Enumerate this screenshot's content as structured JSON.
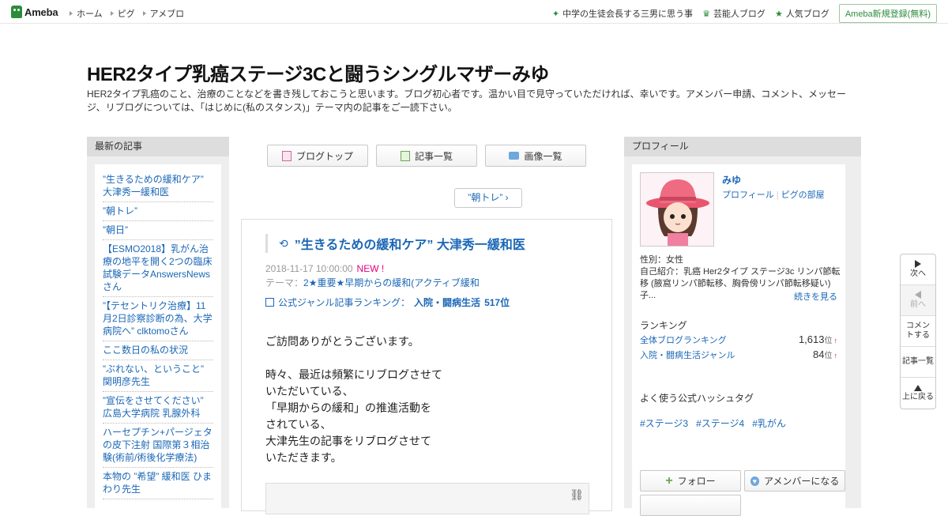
{
  "topbar": {
    "logo": "Ameba",
    "nav": [
      "ホーム",
      "ピグ",
      "アメブロ"
    ],
    "right_links": [
      "中学の生徒会長する三男に思う事",
      "芸能人ブログ",
      "人気ブログ"
    ],
    "signup": "Ameba新規登録(無料)"
  },
  "header": {
    "title": "HER2タイプ乳癌ステージ3Cと闘うシングルマザーみゆ",
    "description": "HER2タイプ乳癌のこと、治療のことなどを書き残しておこうと思います。ブログ初心者です。温かい目で見守っていただければ、幸いです。アメンバー申請、コメント、メッセージ、リブログについては、「はじめに(私のスタンス)」テーマ内の記事をご一読下さい。"
  },
  "left": {
    "heading": "最新の記事",
    "items": [
      "”生きるための緩和ケア” 大津秀一緩和医",
      "”朝トレ”",
      "”朝日”",
      "【ESMO2018】乳がん治療の地平を開く2つの臨床試験データAnswersNewsさん",
      "”【テセントリク治療】11月2日診察診断の為、大学病院へ” clktomoさん",
      "ここ数日の私の状況",
      "”ぶれない、ということ” 関明彦先生",
      "”宣伝をさせてください” 広島大学病院 乳腺外科",
      "ハーセプチン+パージェタの皮下注射 国際第３相治験(術前/術後化学療法)",
      "本物の ”希望” 緩和医 ひまわり先生"
    ]
  },
  "center": {
    "buttons": [
      "ブログトップ",
      "記事一覧",
      "画像一覧"
    ],
    "next": "”朝トレ”",
    "article": {
      "title": "”生きるための緩和ケア” 大津秀一緩和医",
      "date": "2018-11-17 10:00:00",
      "new_badge": "NEW !",
      "theme_label": "テーマ：",
      "theme": "2★重要★早期からの緩和(アクティブ緩和",
      "ranking_label": "公式ジャンル記事ランキング：",
      "ranking_genre": "入院・闘病生活",
      "ranking_value": "517位",
      "body": [
        "ご訪問ありがとうございます。",
        "",
        "時々、最近は頻繁にリブログさせて",
        "いただいている、",
        "「早期からの緩和」の推進活動を",
        "されている、",
        "大津先生の記事をリブログさせて",
        "いただきます。"
      ]
    }
  },
  "right": {
    "heading": "プロフィール",
    "name": "みゆ",
    "links": [
      "プロフィール",
      "ピグの部屋"
    ],
    "gender": "性別：女性",
    "intro": "自己紹介：乳癌 Her2タイプ ステージ3c リンパ節転移 (腋窩リンパ節転移、胸骨傍リンパ節転移疑い) 子...",
    "more": "続きを見る",
    "ranking_title": "ランキング",
    "rankings": [
      {
        "label": "全体ブログランキング",
        "value": "1,613",
        "unit": "位",
        "arrow": "↑"
      },
      {
        "label": "入院・闘病生活ジャンル",
        "value": "84",
        "unit": "位",
        "arrow": "↑"
      }
    ],
    "hashtag_title": "よく使う公式ハッシュタグ",
    "hashtags": [
      "#ステージ3",
      "#ステージ4",
      "#乳がん"
    ],
    "follow": "フォロー",
    "amember": "アメンバーになる"
  },
  "floatnav": {
    "next": "次へ",
    "prev": "前へ",
    "comment": "コメントする",
    "list": "記事一覧",
    "top": "上に戻る"
  }
}
